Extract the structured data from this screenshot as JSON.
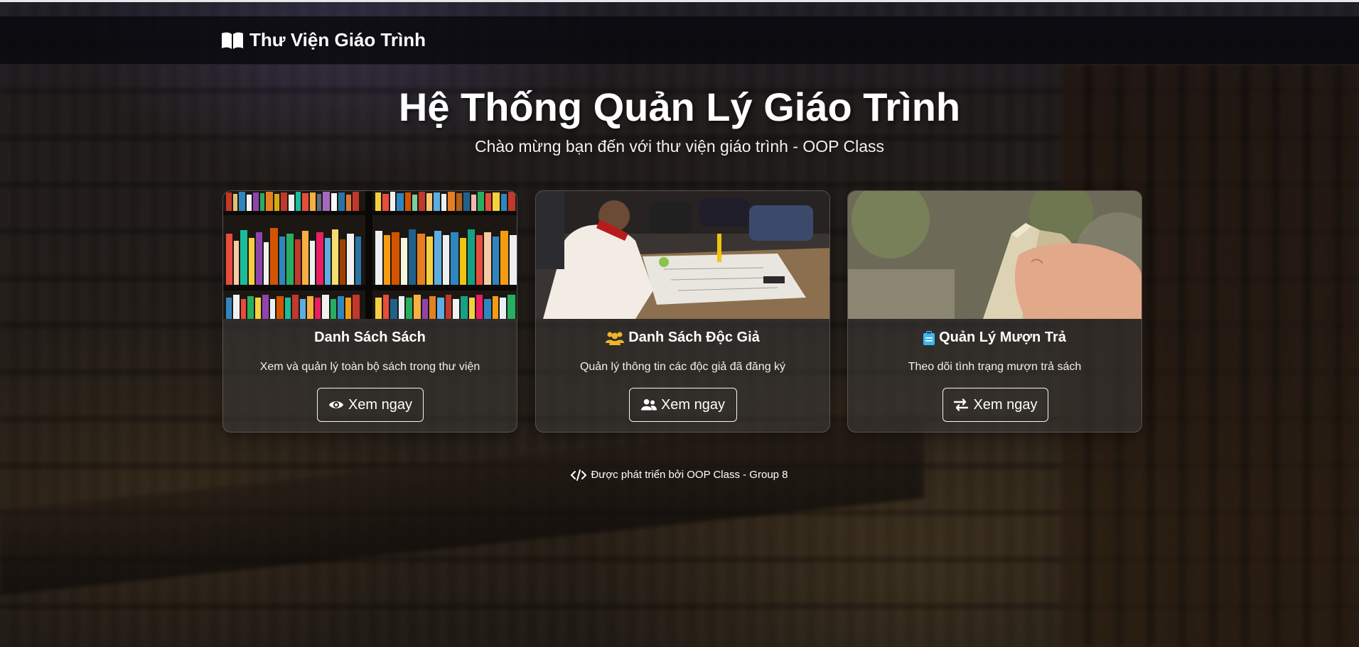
{
  "navbar": {
    "brand_icon": "book-open-icon",
    "brand_title": "Thư Viện Giáo Trình"
  },
  "hero": {
    "title": "Hệ Thống Quản Lý Giáo Trình",
    "subtitle": "Chào mừng bạn đến với thư viện giáo trình - OOP Class"
  },
  "cards": [
    {
      "image": "bookshelf-photo",
      "title_icon": "",
      "title": "Danh Sách Sách",
      "description": "Xem và quản lý toàn bộ sách trong thư viện",
      "button_icon": "eye-icon",
      "button_label": "Xem ngay"
    },
    {
      "image": "students-table-photo",
      "title_icon": "users-icon",
      "title": "Danh Sách Độc Giả",
      "description": "Quản lý thông tin các độc giả đã đăng ký",
      "button_icon": "user-group-icon",
      "button_label": "Xem ngay"
    },
    {
      "image": "hand-holding-book-photo",
      "title_icon": "clipboard-icon",
      "title": "Quản Lý Mượn Trả",
      "description": "Theo dõi tình trạng mượn trả sách",
      "button_icon": "exchange-arrows-icon",
      "button_label": "Xem ngay"
    }
  ],
  "footer": {
    "icon": "code-icon",
    "text": "Được phát triển bởi OOP Class - Group 8"
  },
  "colors": {
    "navbar_bg": "#08080e",
    "users_icon": "#f0b429",
    "clipboard_icon": "#3fb6f0",
    "button_border": "#f5f5f5"
  }
}
